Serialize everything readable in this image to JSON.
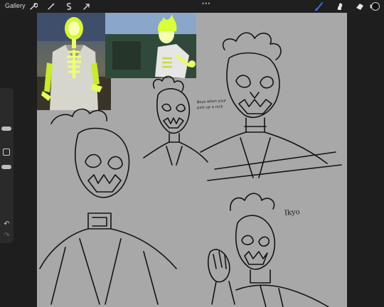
{
  "toolbar": {
    "gallery_label": "Gallery",
    "left_tools": [
      "wrench-icon",
      "magic-wand-icon",
      "selection-icon",
      "transform-arrow-icon"
    ],
    "more_label": "•••",
    "right_tools": [
      "brush-icon",
      "smudge-icon",
      "eraser-icon",
      "layers-icon"
    ],
    "active_color": "#111111"
  },
  "sidebar": {
    "controls": [
      "brush-size-slider",
      "modify-button",
      "opacity-slider",
      "undo-button",
      "redo-button"
    ],
    "undo_label": "↶",
    "redo_label": "↷"
  },
  "canvas": {
    "background": "#a8a8a8",
    "handwritten_note": "Boys when your pick up a rock",
    "signature": "Ikyo"
  }
}
